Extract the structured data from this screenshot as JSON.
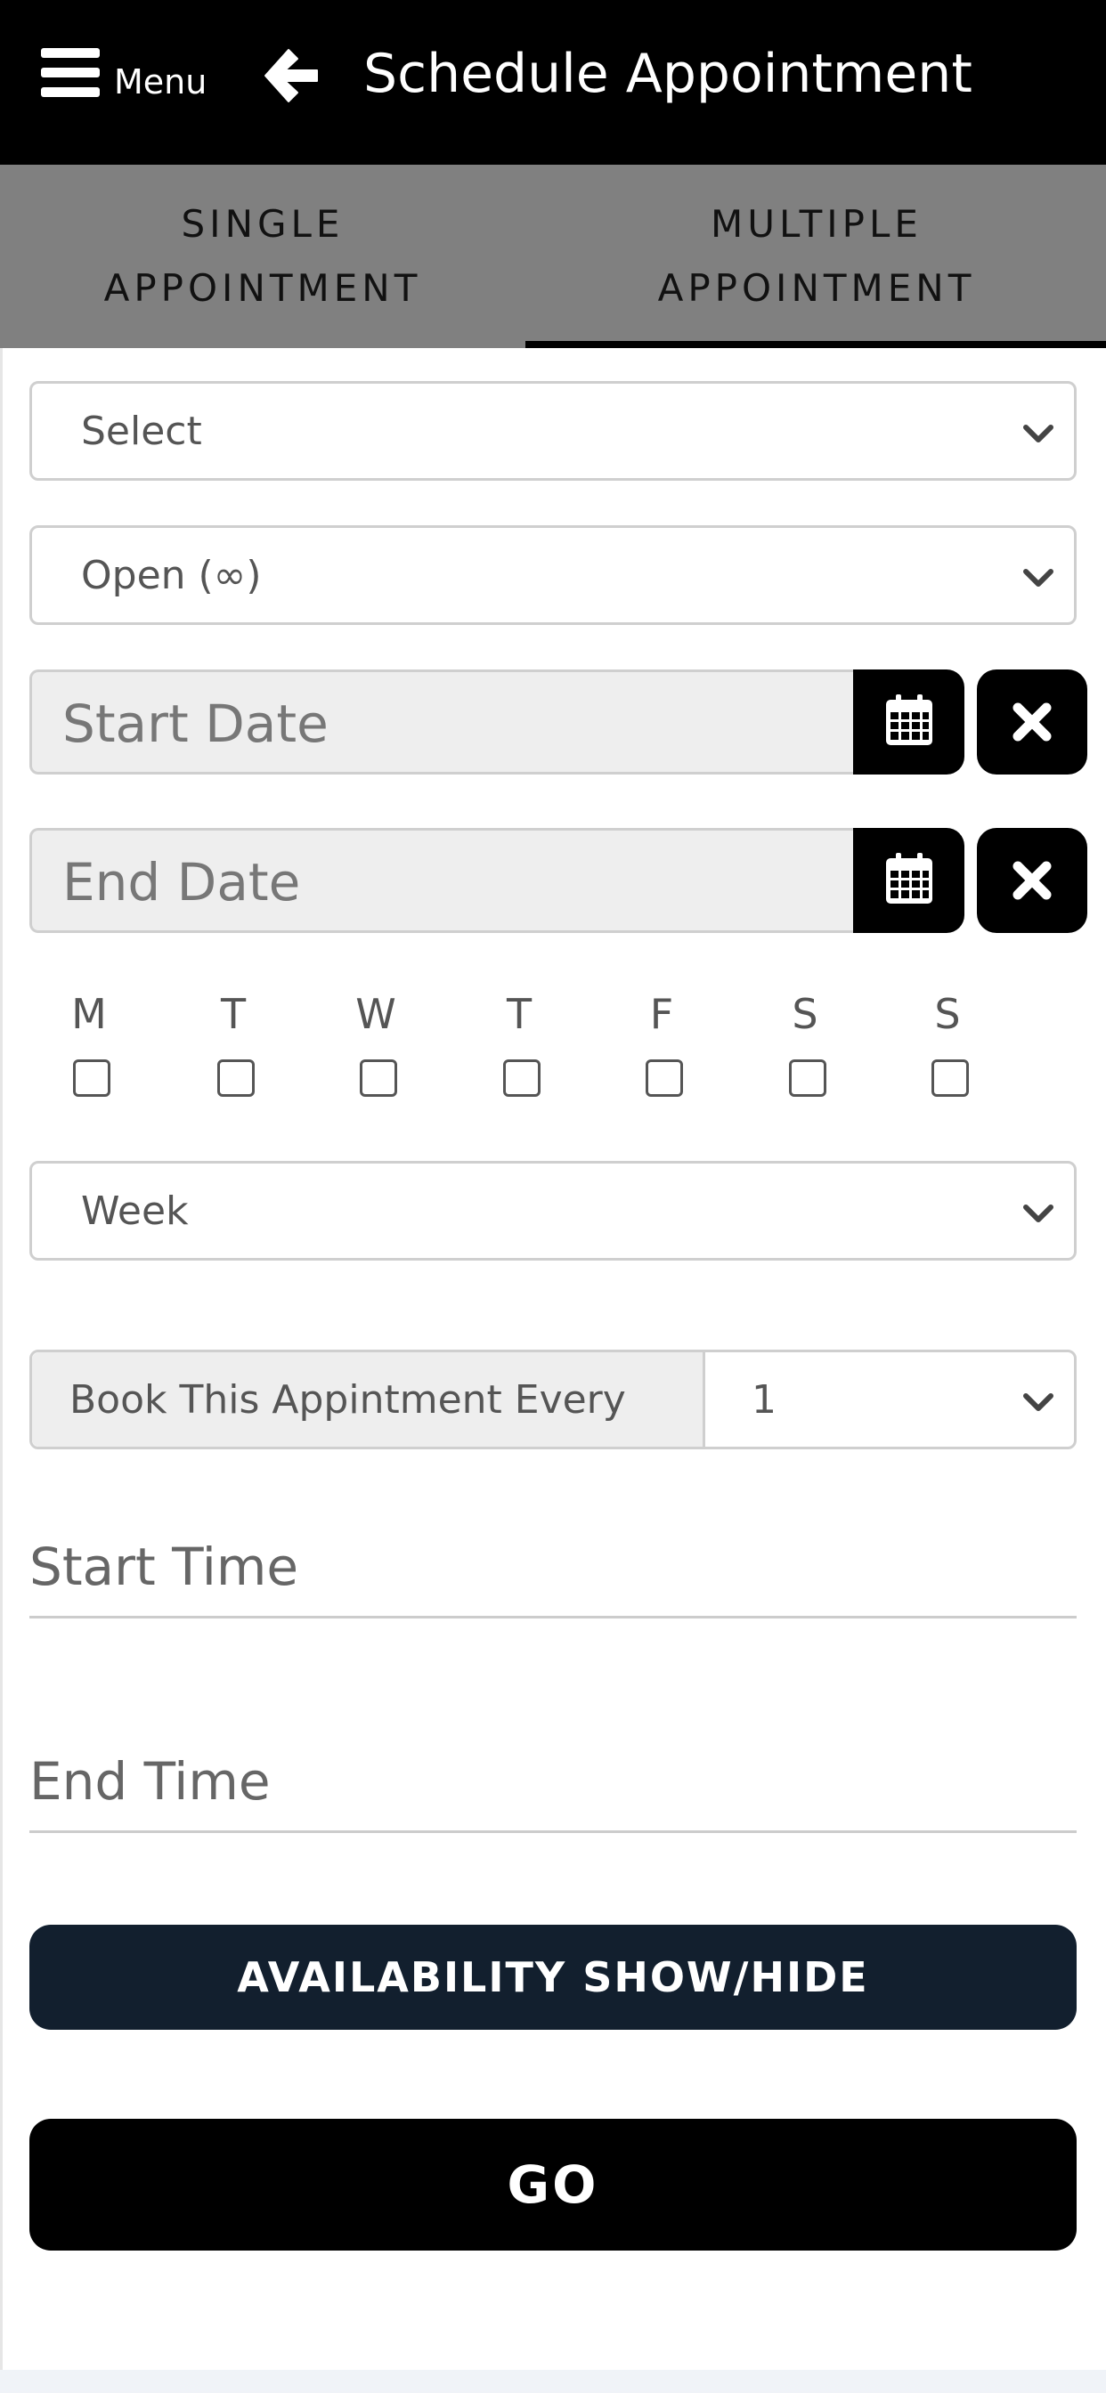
{
  "header": {
    "menu_label": "Menu",
    "title": "Schedule Appointment",
    "icons": {
      "menu": "hamburger-icon",
      "back": "arrow-left-icon"
    }
  },
  "tabs": [
    {
      "line1": "SINGLE",
      "line2": "APPOINTMENT",
      "active": false
    },
    {
      "line1": "MULTIPLE",
      "line2": "APPOINTMENT",
      "active": true
    }
  ],
  "form": {
    "service_select": "Select",
    "limit_select": "Open (∞)",
    "start_date_placeholder": "Start Date",
    "end_date_placeholder": "End Date",
    "days": [
      "M",
      "T",
      "W",
      "T",
      "F",
      "S",
      "S"
    ],
    "frequency_select": "Week",
    "book_every_label": "Book This Appintment Every",
    "book_every_value": "1",
    "start_time_placeholder": "Start Time",
    "end_time_placeholder": "End Time",
    "icons": {
      "calendar": "calendar-icon",
      "clear": "close-icon",
      "dropdown": "chevron-down-icon"
    }
  },
  "buttons": {
    "availability": "AVAILABILITY SHOW/HIDE",
    "go": "GO"
  },
  "colors": {
    "header_bg": "#000000",
    "tabs_bg": "#808080",
    "availability_bg": "#121f2e",
    "go_bg": "#000000"
  }
}
